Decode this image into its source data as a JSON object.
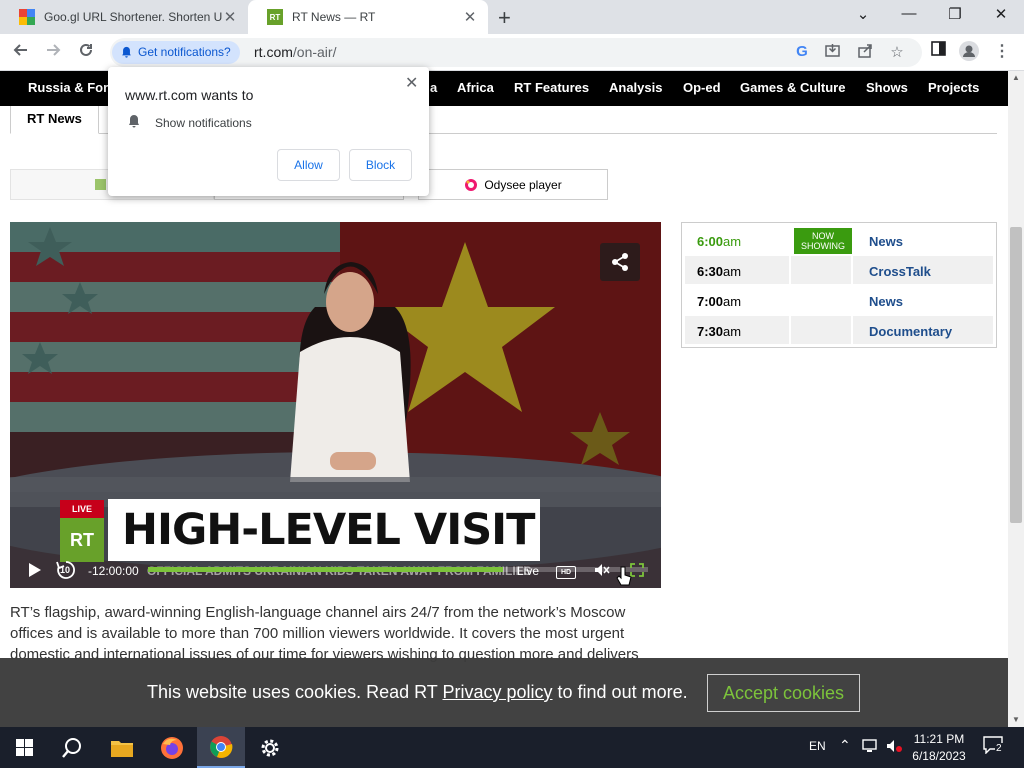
{
  "browser": {
    "tabs": [
      {
        "title": "Goo.gl URL Shortener. Shorten U",
        "close": "✕",
        "favicon": "google-favicon"
      },
      {
        "title": "RT News — RT",
        "close": "✕",
        "favicon": "rt-favicon"
      }
    ],
    "new_tab": "+",
    "window_controls": {
      "tab_search": "⌄",
      "minimize": "—",
      "restore": "❐",
      "close": "✕"
    },
    "notification_chip": "Get notifications?",
    "url_host": "rt.com",
    "url_path": "/on-air/"
  },
  "site_nav": {
    "items": [
      "Russia & Former",
      "a",
      "Africa",
      "RT Features",
      "Analysis",
      "Op-ed",
      "Games & Culture",
      "Shows",
      "Projects"
    ]
  },
  "subtabs": {
    "active": "RT News"
  },
  "player_tabs": {
    "rt_player": "RT",
    "odysee": "Odysee player"
  },
  "video": {
    "live_badge": "LIVE",
    "logo": "RT",
    "headline": "HIGH-LEVEL VISIT",
    "ticker": "OFFICIAL ADMITS UKRAINIAN KIDS TAKEN AWAY FROM FAMILIES",
    "time": "-12:00:00",
    "rewind": "10",
    "live_label": "Live",
    "hd": "HD",
    "progress": 0.71
  },
  "schedule": [
    {
      "hour": "6:00",
      "suffix": "am",
      "badge_line1": "NOW",
      "badge_line2": "SHOWING",
      "show": "News"
    },
    {
      "hour": "6:30",
      "suffix": "am",
      "show": "CrossTalk"
    },
    {
      "hour": "7:00",
      "suffix": "am",
      "show": "News"
    },
    {
      "hour": "7:30",
      "suffix": "am",
      "show": "Documentary"
    }
  ],
  "description": {
    "line1": "RT’s flagship, award-winning English-language channel airs 24/7 from the network’s Moscow",
    "line2": "offices and is available to more than 700 million viewers worldwide. It covers the most urgent",
    "line3": "domestic and international issues of our time for viewers wishing to question more and delivers"
  },
  "cookie": {
    "text_before": "This website uses cookies. Read RT ",
    "link": "Privacy policy",
    "text_after": " to find out more.",
    "button": "Accept cookies"
  },
  "permission_popup": {
    "title": "www.rt.com wants to",
    "item": "Show notifications",
    "allow": "Allow",
    "block": "Block",
    "close": "✕"
  },
  "taskbar": {
    "language": "EN",
    "time": "11:21 PM",
    "date": "6/18/2023",
    "notifications": "2"
  },
  "colors": {
    "rt_green": "#7cc33b",
    "schedule_now": "#3a9b0f",
    "schedule_link": "#1f4e8c",
    "chip_bg": "#d3e3fd",
    "chip_text": "#0b57d0"
  }
}
